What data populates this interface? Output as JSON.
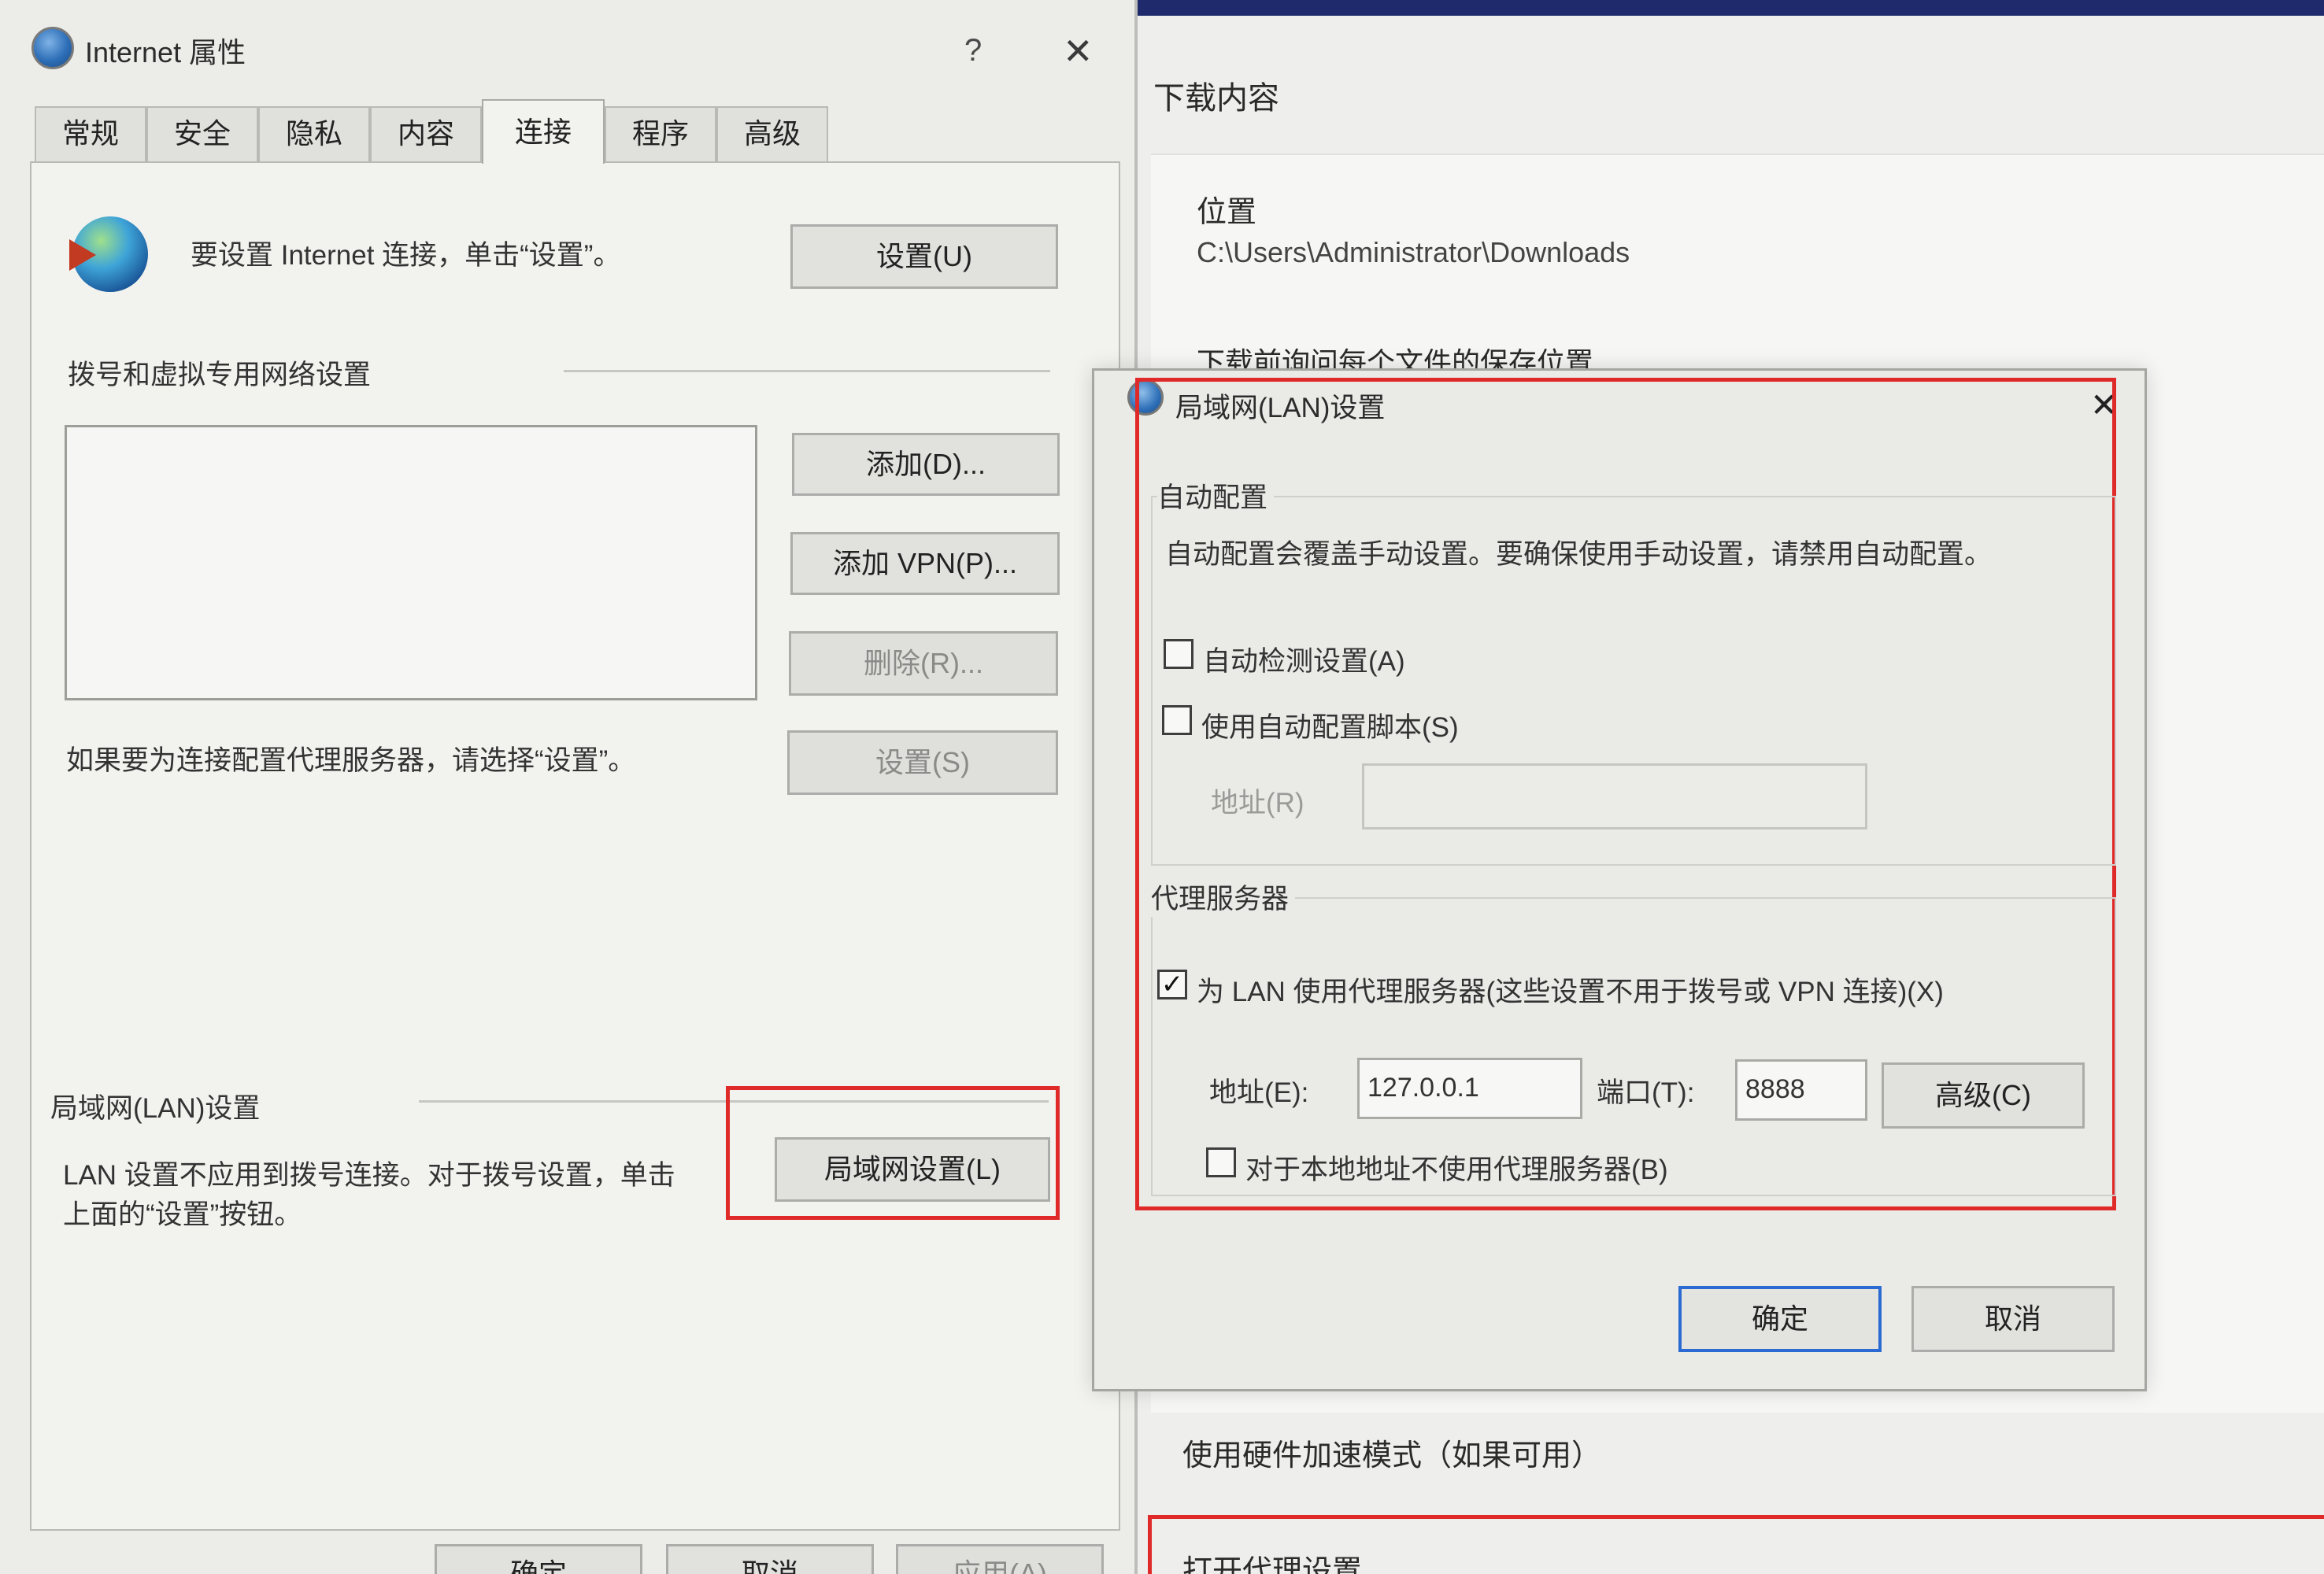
{
  "background": {
    "downloads_heading": "下载内容",
    "location_label": "位置",
    "location_path": "C:\\Users\\Administrator\\Downloads",
    "ask_location_text": "下载前询问每个文件的保存位置",
    "hw_accel_text": "使用硬件加速模式（如果可用）",
    "open_proxy_text": "打开代理设置"
  },
  "ie_dialog": {
    "title": "Internet 属性",
    "help": "?",
    "close": "✕",
    "tabs": [
      "常规",
      "安全",
      "隐私",
      "内容",
      "连接",
      "程序",
      "高级"
    ],
    "active_tab": "连接",
    "setup_text": "要设置 Internet 连接，单击“设置”。",
    "setup_button": "设置(U)",
    "dialup_section": "拨号和虚拟专用网络设置",
    "add_button": "添加(D)...",
    "add_vpn_button": "添加 VPN(P)...",
    "remove_button": "删除(R)...",
    "proxy_hint": "如果要为连接配置代理服务器，请选择“设置”。",
    "settings_button": "设置(S)",
    "lan_section": "局域网(LAN)设置",
    "lan_note_line1": "LAN 设置不应用到拨号连接。对于拨号设置，单击",
    "lan_note_line2": "上面的“设置”按钮。",
    "lan_settings_button": "局域网设置(L)",
    "bottom_ok": "确定",
    "bottom_cancel": "取消",
    "bottom_apply": "应用(A)"
  },
  "lan_dialog": {
    "title": "局域网(LAN)设置",
    "close": "✕",
    "auto_config_section": "自动配置",
    "auto_config_desc": "自动配置会覆盖手动设置。要确保使用手动设置，请禁用自动配置。",
    "auto_detect_label": "自动检测设置(A)",
    "auto_detect_checked": false,
    "use_script_label": "使用自动配置脚本(S)",
    "use_script_checked": false,
    "script_address_label": "地址(R)",
    "script_address_value": "",
    "proxy_section": "代理服务器",
    "use_proxy_label": "为 LAN 使用代理服务器(这些设置不用于拨号或 VPN 连接)(X)",
    "use_proxy_checked": true,
    "proxy_address_label": "地址(E):",
    "proxy_address_value": "127.0.0.1",
    "port_label": "端口(T):",
    "port_value": "8888",
    "advanced_button": "高级(C)",
    "bypass_local_label": "对于本地地址不使用代理服务器(B)",
    "bypass_local_checked": false,
    "ok_button": "确定",
    "cancel_button": "取消"
  },
  "colors": {
    "highlight_box": "#e02a2a",
    "default_button_border": "#2b6ad2"
  }
}
